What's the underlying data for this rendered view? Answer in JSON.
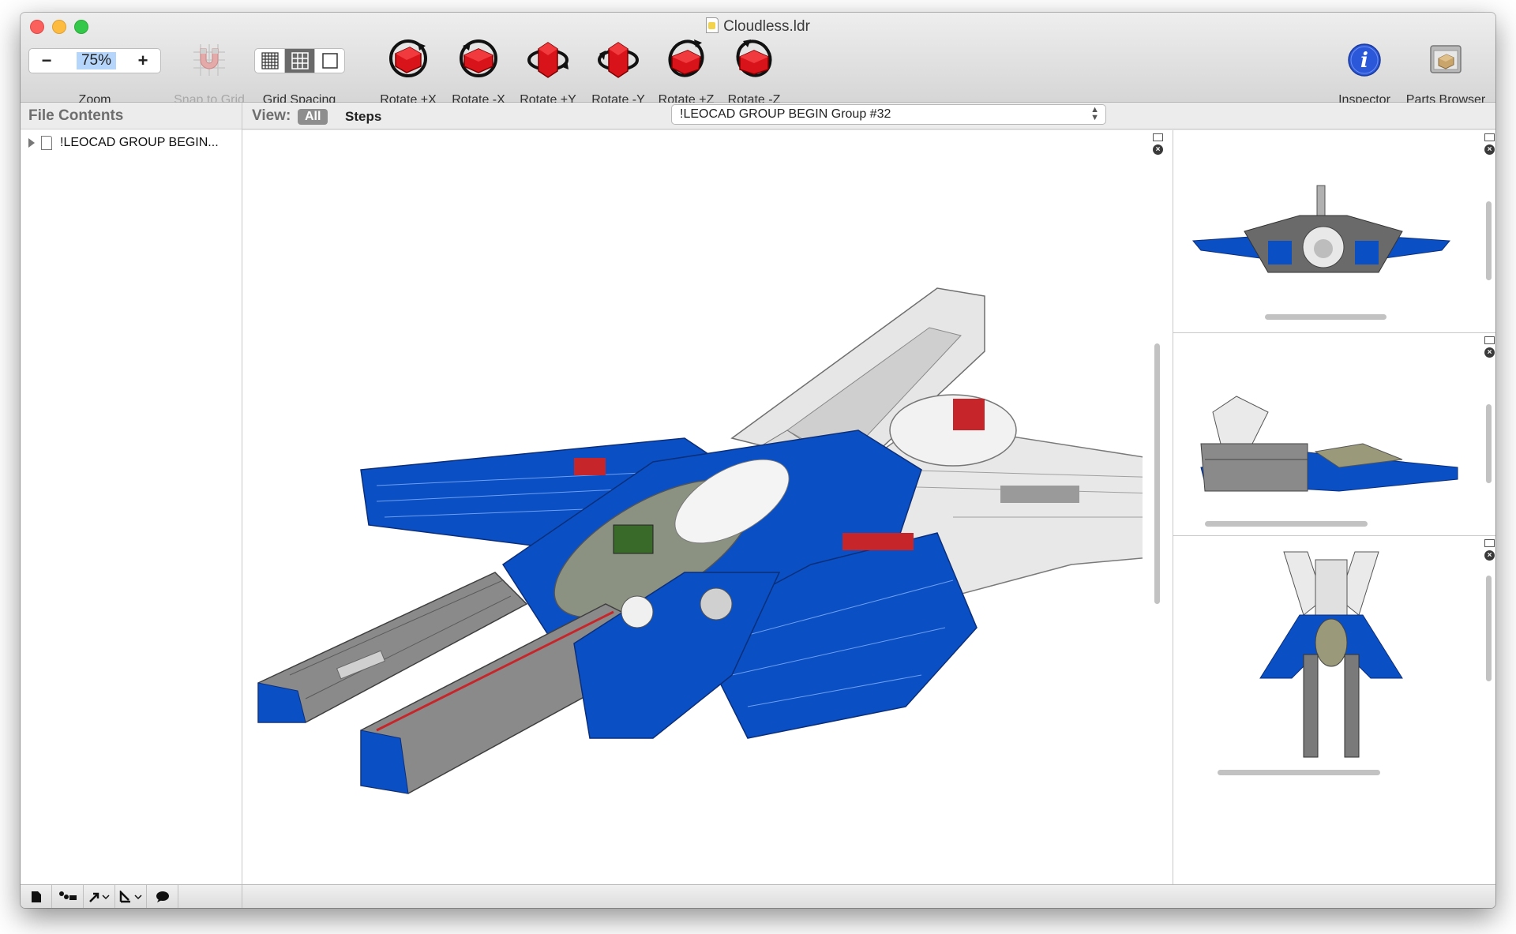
{
  "window": {
    "title": "Cloudless.ldr"
  },
  "toolbar": {
    "zoom": {
      "value": "75%",
      "minus": "−",
      "plus": "+",
      "label": "Zoom"
    },
    "snap_label": "Snap to Grid",
    "grid_spacing_label": "Grid Spacing",
    "rotate": [
      {
        "label": "Rotate +X"
      },
      {
        "label": "Rotate -X"
      },
      {
        "label": "Rotate +Y"
      },
      {
        "label": "Rotate -Y"
      },
      {
        "label": "Rotate +Z"
      },
      {
        "label": "Rotate -Z"
      }
    ],
    "inspector_label": "Inspector",
    "parts_browser_label": "Parts Browser"
  },
  "sidebar": {
    "header": "File Contents",
    "items": [
      {
        "label": "!LEOCAD GROUP BEGIN..."
      }
    ]
  },
  "view_bar": {
    "label": "View:",
    "all": "All",
    "steps": "Steps",
    "selected_step": "!LEOCAD GROUP BEGIN Group #32"
  },
  "colors": {
    "brick_blue": "#0a4fc4",
    "brick_gray": "#8a8a8a",
    "brick_white": "#f2f2f2",
    "rotate_red": "#d8141a",
    "inspector_blue": "#2b57d9"
  },
  "icons": [
    "doc-icon",
    "magnet-icon",
    "grid-fine-icon",
    "grid-medium-icon",
    "grid-off-icon",
    "rotate-icon",
    "info-icon",
    "parts-box-icon",
    "new-file-icon",
    "steps-icon",
    "arrow-icon",
    "rotate-menu-icon",
    "comment-icon",
    "close-icon"
  ]
}
